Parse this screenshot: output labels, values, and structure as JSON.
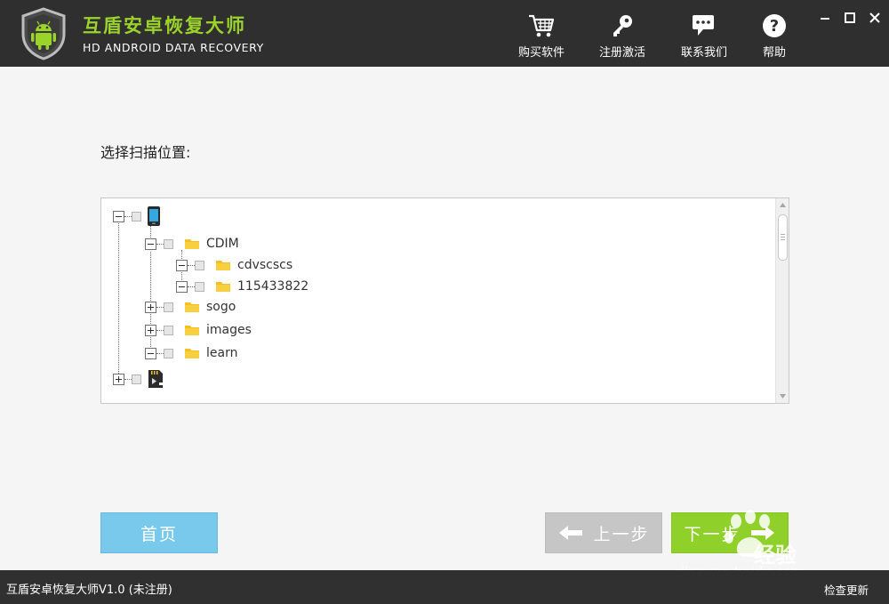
{
  "header": {
    "title": "互盾安卓恢复大师",
    "subtitle": "HD ANDROID DATA RECOVERY",
    "buttons": [
      {
        "label": "购买软件",
        "icon": "cart-icon"
      },
      {
        "label": "注册激活",
        "icon": "key-icon"
      },
      {
        "label": "联系我们",
        "icon": "chat-icon"
      },
      {
        "label": "帮助",
        "icon": "help-icon"
      }
    ],
    "window_controls": [
      "minimize-icon",
      "maximize-icon",
      "close-icon"
    ]
  },
  "main": {
    "scan_label": "选择扫描位置:",
    "tree": {
      "root_phone": {
        "icon": "phone-icon",
        "expanded": true
      },
      "items": [
        {
          "label": "CDIM",
          "expanded": true,
          "children": [
            {
              "label": "cdvscscs",
              "expanded": true
            },
            {
              "label": "115433822",
              "expanded": true
            }
          ]
        },
        {
          "label": "sogo",
          "expanded": false
        },
        {
          "label": "images",
          "expanded": false
        },
        {
          "label": "learn",
          "expanded": true
        }
      ],
      "root_sdcard": {
        "icon": "sdcard-icon",
        "expanded": false
      }
    }
  },
  "buttons": {
    "home": "首页",
    "prev": "上一步",
    "next": "下一步"
  },
  "statusbar": {
    "app_status": "互盾安卓恢复大师V1.0 (未注册)",
    "check_update": "检查更新"
  },
  "watermark": {
    "brand": "经验",
    "url": "jingyan.baidu.com"
  },
  "colors": {
    "header_bg": "#2f2f2f",
    "title_green": "#9bd32b",
    "home_button": "#79c9ec",
    "prev_button": "#c6c6c6",
    "next_button": "#8fd12a",
    "folder_yellow": "#f5c022"
  }
}
